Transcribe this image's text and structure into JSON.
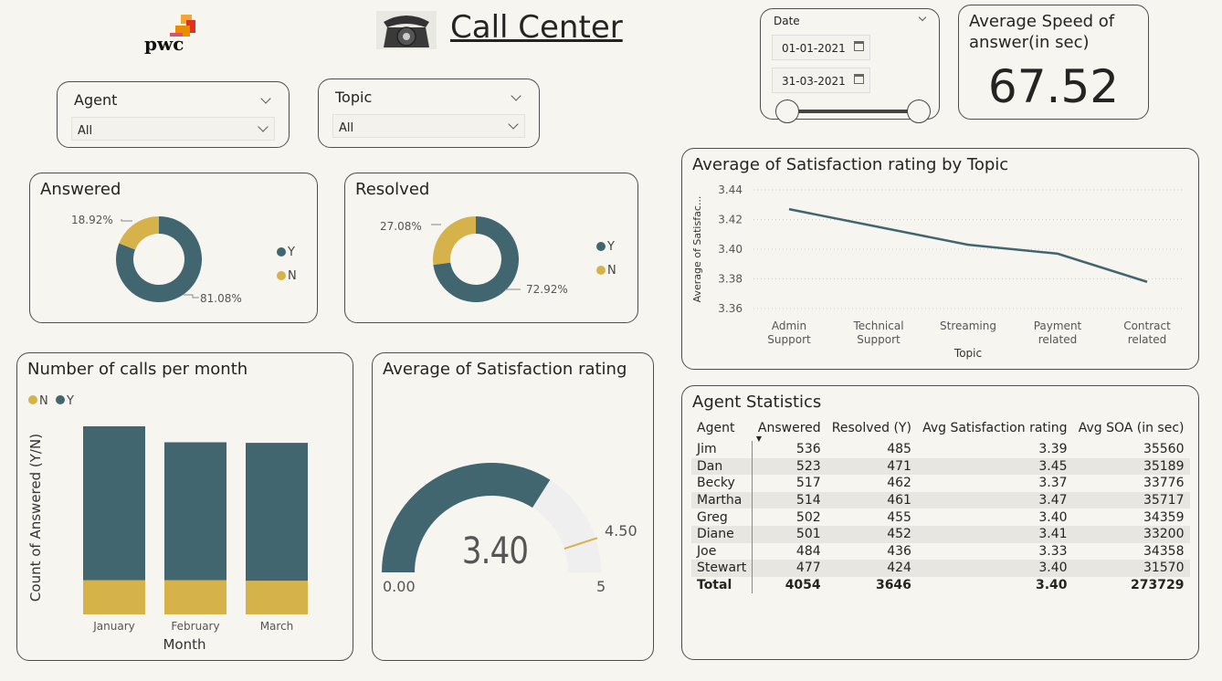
{
  "header": {
    "logo_text": "pwc",
    "title": "Call Center"
  },
  "slicers": {
    "agent": {
      "label": "Agent",
      "value": "All"
    },
    "topic": {
      "label": "Topic",
      "value": "All"
    },
    "date": {
      "label": "Date",
      "start": "01-01-2021",
      "end": "31-03-2021"
    }
  },
  "kpi": {
    "title": "Average Speed of answer(in sec)",
    "value": "67.52"
  },
  "answered": {
    "title": "Answered",
    "pct_n": "18.92%",
    "pct_y": "81.08%",
    "legend": [
      "Y",
      "N"
    ]
  },
  "resolved": {
    "title": "Resolved",
    "pct_n": "27.08%",
    "pct_y": "72.92%",
    "legend": [
      "Y",
      "N"
    ]
  },
  "calls_chart": {
    "title": "Number of calls per month"
  },
  "gauge": {
    "title": "Average of Satisfaction rating",
    "value": "3.40",
    "min": "0.00",
    "max": "5",
    "target": "4.50"
  },
  "topic_chart": {
    "title": "Average of Satisfaction rating by Topic"
  },
  "agent_stats": {
    "title": "Agent Statistics",
    "columns": [
      "Agent",
      "Answered",
      "Resolved (Y)",
      "Avg Satisfaction rating",
      "Avg SOA (in sec)"
    ],
    "rows": [
      [
        "Jim",
        "536",
        "485",
        "3.39",
        "35560"
      ],
      [
        "Dan",
        "523",
        "471",
        "3.45",
        "35189"
      ],
      [
        "Becky",
        "517",
        "462",
        "3.37",
        "33776"
      ],
      [
        "Martha",
        "514",
        "461",
        "3.47",
        "35717"
      ],
      [
        "Greg",
        "502",
        "455",
        "3.40",
        "34359"
      ],
      [
        "Diane",
        "501",
        "452",
        "3.41",
        "33200"
      ],
      [
        "Joe",
        "484",
        "436",
        "3.33",
        "34358"
      ],
      [
        "Stewart",
        "477",
        "424",
        "3.40",
        "31570"
      ]
    ],
    "total": [
      "Total",
      "4054",
      "3646",
      "3.40",
      "273729"
    ]
  },
  "colors": {
    "y": "#41666f",
    "n": "#d6b24a",
    "track": "#efefef"
  },
  "chart_data": [
    {
      "type": "pie",
      "title": "Answered",
      "categories": [
        "Y",
        "N"
      ],
      "values": [
        81.08,
        18.92
      ]
    },
    {
      "type": "pie",
      "title": "Resolved",
      "categories": [
        "Y",
        "N"
      ],
      "values": [
        72.92,
        27.08
      ]
    },
    {
      "type": "bar",
      "stacked": true,
      "title": "Number of calls per month",
      "xlabel": "Month",
      "ylabel": "Count of Answered (Y/N)",
      "categories": [
        "January",
        "February",
        "March"
      ],
      "series": [
        {
          "name": "N",
          "values": [
            60,
            60,
            59
          ]
        },
        {
          "name": "Y",
          "values": [
            270,
            242,
            242
          ]
        }
      ],
      "ylim": [
        0,
        330
      ],
      "legend": "top-left"
    },
    {
      "type": "line",
      "title": "Average of Satisfaction rating by Topic",
      "xlabel": "Topic",
      "ylabel": "Average of Satisfac...",
      "categories": [
        "Admin Support",
        "Technical Support",
        "Streaming",
        "Payment related",
        "Contract related"
      ],
      "values": [
        3.427,
        3.415,
        3.403,
        3.397,
        3.378
      ],
      "yticks": [
        "3.36",
        "3.38",
        "3.40",
        "3.42",
        "3.44"
      ],
      "ylim": [
        3.36,
        3.44
      ],
      "grid": true
    }
  ]
}
